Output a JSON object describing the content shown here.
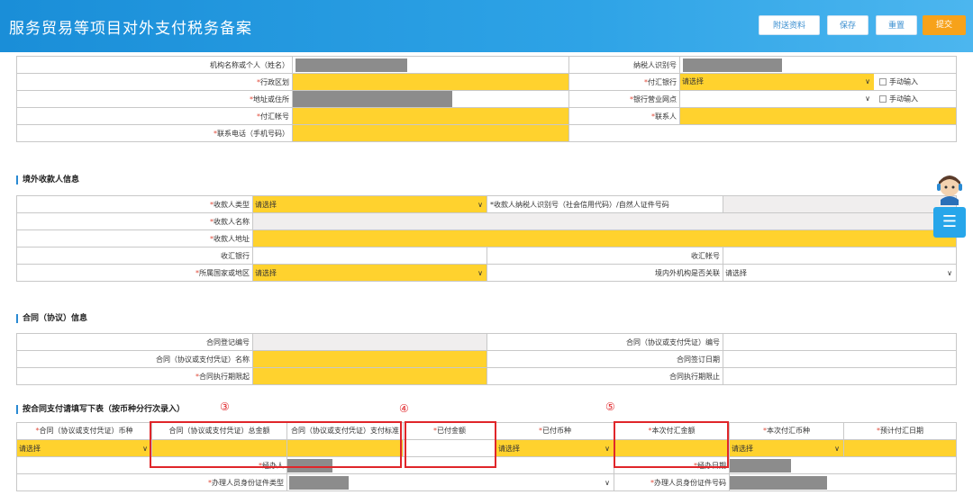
{
  "header": {
    "title": "服务贸易等项目对外支付税务备案",
    "buttons": {
      "attach": "附送资料",
      "save": "保存",
      "reset": "重置",
      "submit": "提交"
    }
  },
  "payer": {
    "org_name_label": "机构名称或个人（姓名）",
    "taxpayer_id_label": "纳税人识别号",
    "region_label": "行政区划",
    "pay_bank_label": "付汇银行",
    "pay_bank_value": "请选择",
    "manual_input_1": "手动输入",
    "address_label": "地址或住所",
    "branch_label": "银行营业网点",
    "manual_input_2": "手动输入",
    "account_label": "付汇帐号",
    "contact_label": "联系人",
    "phone_label": "联系电话（手机号码）"
  },
  "sections": {
    "payee": "境外收款人信息",
    "contract": "合同（协议）信息",
    "by_contract": "按合同支付请填写下表（按币种分行次录入）"
  },
  "payee": {
    "type_label": "收款人类型",
    "type_value": "请选择",
    "tax_id_label": "收款人纳税人识别号（社会信用代码）/自然人证件号码",
    "name_label": "收款人名称",
    "address_label": "收款人地址",
    "bank_label": "收汇银行",
    "account_label": "收汇帐号",
    "country_label": "所属国家或地区",
    "country_value": "请选择",
    "related_label": "境内外机构是否关联",
    "related_value": "请选择"
  },
  "contract": {
    "reg_no_label": "合同登记编号",
    "voucher_no_label": "合同（协议或支付凭证）编号",
    "name_label": "合同（协议或支付凭证）名称",
    "sign_date_label": "合同签订日期",
    "start_label": "合同执行期限起",
    "end_label": "合同执行期限止"
  },
  "payment": {
    "circle_3": "③",
    "circle_4": "④",
    "circle_5": "⑤",
    "headers": [
      "合同（协议或支付凭证）币种",
      "合同（协议或支付凭证）总金额",
      "合同（协议或支付凭证）支付标准",
      "已付金额",
      "已付币种",
      "本次付汇金额",
      "本次付汇币种",
      "预计付汇日期"
    ],
    "currency_value": "请选择",
    "paid_currency_value": "请选择",
    "this_currency_value": "请选择",
    "handler_label": "经办人",
    "handle_date_label": "经办日期",
    "id_type_label": "办理人员身份证件类型",
    "id_no_label": "办理人员身份证件号码"
  }
}
